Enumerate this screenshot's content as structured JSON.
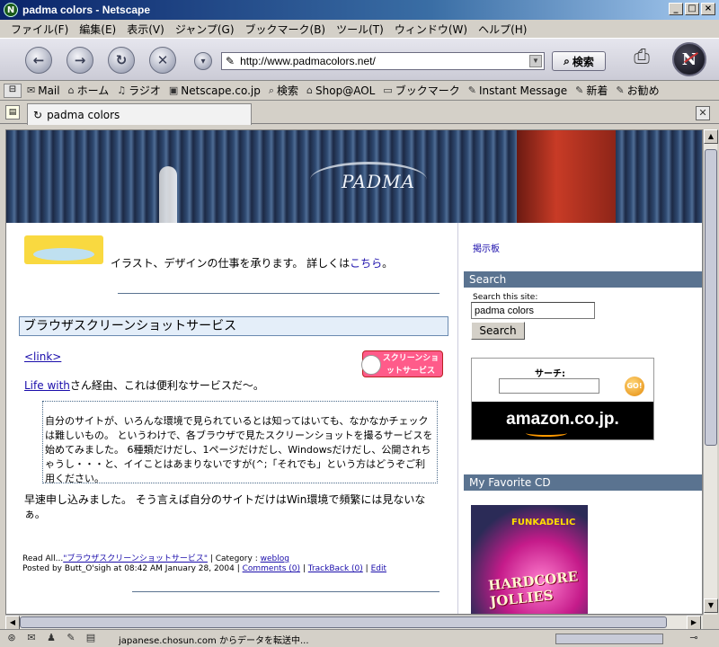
{
  "window": {
    "title": "padma colors - Netscape"
  },
  "menu": [
    "ファイル(F)",
    "編集(E)",
    "表示(V)",
    "ジャンプ(G)",
    "ブックマーク(B)",
    "ツール(T)",
    "ウィンドウ(W)",
    "ヘルプ(H)"
  ],
  "navbar": {
    "url": "http://www.padmacolors.net/",
    "search_label": "検索"
  },
  "personal_toolbar": [
    {
      "icon": "mail-icon",
      "label": "Mail"
    },
    {
      "icon": "home-icon",
      "label": "ホーム"
    },
    {
      "icon": "radio-icon",
      "label": "ラジオ"
    },
    {
      "icon": "my-netscape-icon",
      "label": "Netscape.co.jp"
    },
    {
      "icon": "search-icon",
      "label": "検索"
    },
    {
      "icon": "shop-icon",
      "label": "Shop@AOL"
    },
    {
      "icon": "bookmark-folder-icon",
      "label": "ブックマーク"
    },
    {
      "icon": "bookmark-icon",
      "label": "Instant Message"
    },
    {
      "icon": "bookmark-icon",
      "label": "新着"
    },
    {
      "icon": "bookmark-icon",
      "label": "お勧め"
    }
  ],
  "tab": {
    "title": "padma colors"
  },
  "banner": {
    "logo": "PADMA"
  },
  "main": {
    "intro_text": "イラスト、デザインの仕事を承ります。 詳しくは",
    "intro_link": "こちら",
    "intro_suffix": "。",
    "post_title": "ブラウザスクリーンショットサービス",
    "link_label": "<link>",
    "badge_text": "スクリーンショットサービス",
    "via_link": "Life with",
    "via_text": "さん経由、これは便利なサービスだ〜。",
    "quote": "自分のサイトが、いろんな環境で見られているとは知ってはいても、なかなかチェックは難しいもの。 というわけで、各ブラウザで見たスクリーンショットを撮るサービスを始めてみました。 6種類だけだし、1ページだけだし、Windowsだけだし、公開されちゃうし・・・と、イイことはあまりないですが(^;「それでも」という方はどうぞご利用ください。",
    "paragraph": "早速申し込みました。 そう言えば自分のサイトだけはWin環境で頻繁には見ないなぁ。",
    "read_all_prefix": "Read All...",
    "read_all_link": "\"ブラウザスクリーンショットサービス\"",
    "category_prefix": " | Category : ",
    "category_link": "weblog",
    "posted_text": "Posted by Butt_O'sigh at 08:42 AM January 28, 2004 | ",
    "comments_link": "Comments (0)",
    "trackback_link": "TrackBack (0)",
    "edit_link": "Edit",
    "sep": " | "
  },
  "sidebar": {
    "bbs_link": "掲示板",
    "search_heading": "Search",
    "search_label": "Search this site:",
    "search_value": "padma colors",
    "search_button": "Search",
    "amazon_label": "サーチ:",
    "amazon_go": "GO!",
    "amazon_brand": "amazon.co.jp.",
    "cd_heading": "My Favorite CD",
    "cd_brand": "FUNKADELIC",
    "cd_title": "HARDCORE JOLLIES"
  },
  "status": {
    "text": "japanese.chosun.com からデータを転送中..."
  }
}
